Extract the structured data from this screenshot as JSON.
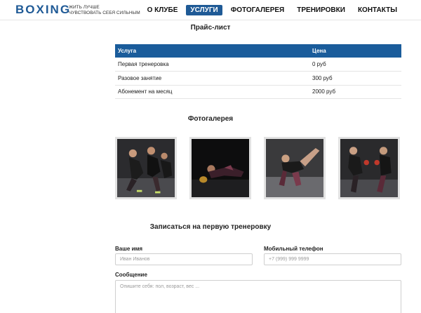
{
  "header": {
    "logo": "BOXING",
    "tagline_line1": "ЖИТЬ ЛУЧШЕ",
    "tagline_line2": "ЧУВСТВОВАТЬ СЕБЯ СИЛЬНЫМ",
    "nav": [
      {
        "label": "О КЛУБЕ",
        "active": false
      },
      {
        "label": "УСЛУГИ",
        "active": true
      },
      {
        "label": "ФОТОГАЛЕРЕЯ",
        "active": false
      },
      {
        "label": "ТРЕНИРОВКИ",
        "active": false
      },
      {
        "label": "КОНТАКТЫ",
        "active": false
      }
    ]
  },
  "pricing": {
    "title": "Прайс-лист",
    "headers": [
      "Услуга",
      "Цена"
    ],
    "rows": [
      [
        "Первая тренеровка",
        "0 руб"
      ],
      [
        "Разовое занятие",
        "300 руб"
      ],
      [
        "Абонемент на месяц",
        "2000 руб"
      ]
    ]
  },
  "gallery": {
    "title": "Фотогалерея",
    "photos": [
      "group-workout-photo",
      "stretching-photo",
      "yoga-pose-photo",
      "partner-training-photo"
    ]
  },
  "form": {
    "title": "Записаться на первую тренеровку",
    "name_label": "Ваше имя",
    "name_placeholder": "Иван Иванов",
    "phone_label": "Мобильный телефон",
    "phone_placeholder": "+7 (999) 999 9999",
    "message_label": "Сообщение",
    "message_placeholder": "Опишите себя: пол, возраст, вес ..."
  },
  "colors": {
    "brand": "#1f5a96",
    "table_header": "#1a5c9b"
  }
}
